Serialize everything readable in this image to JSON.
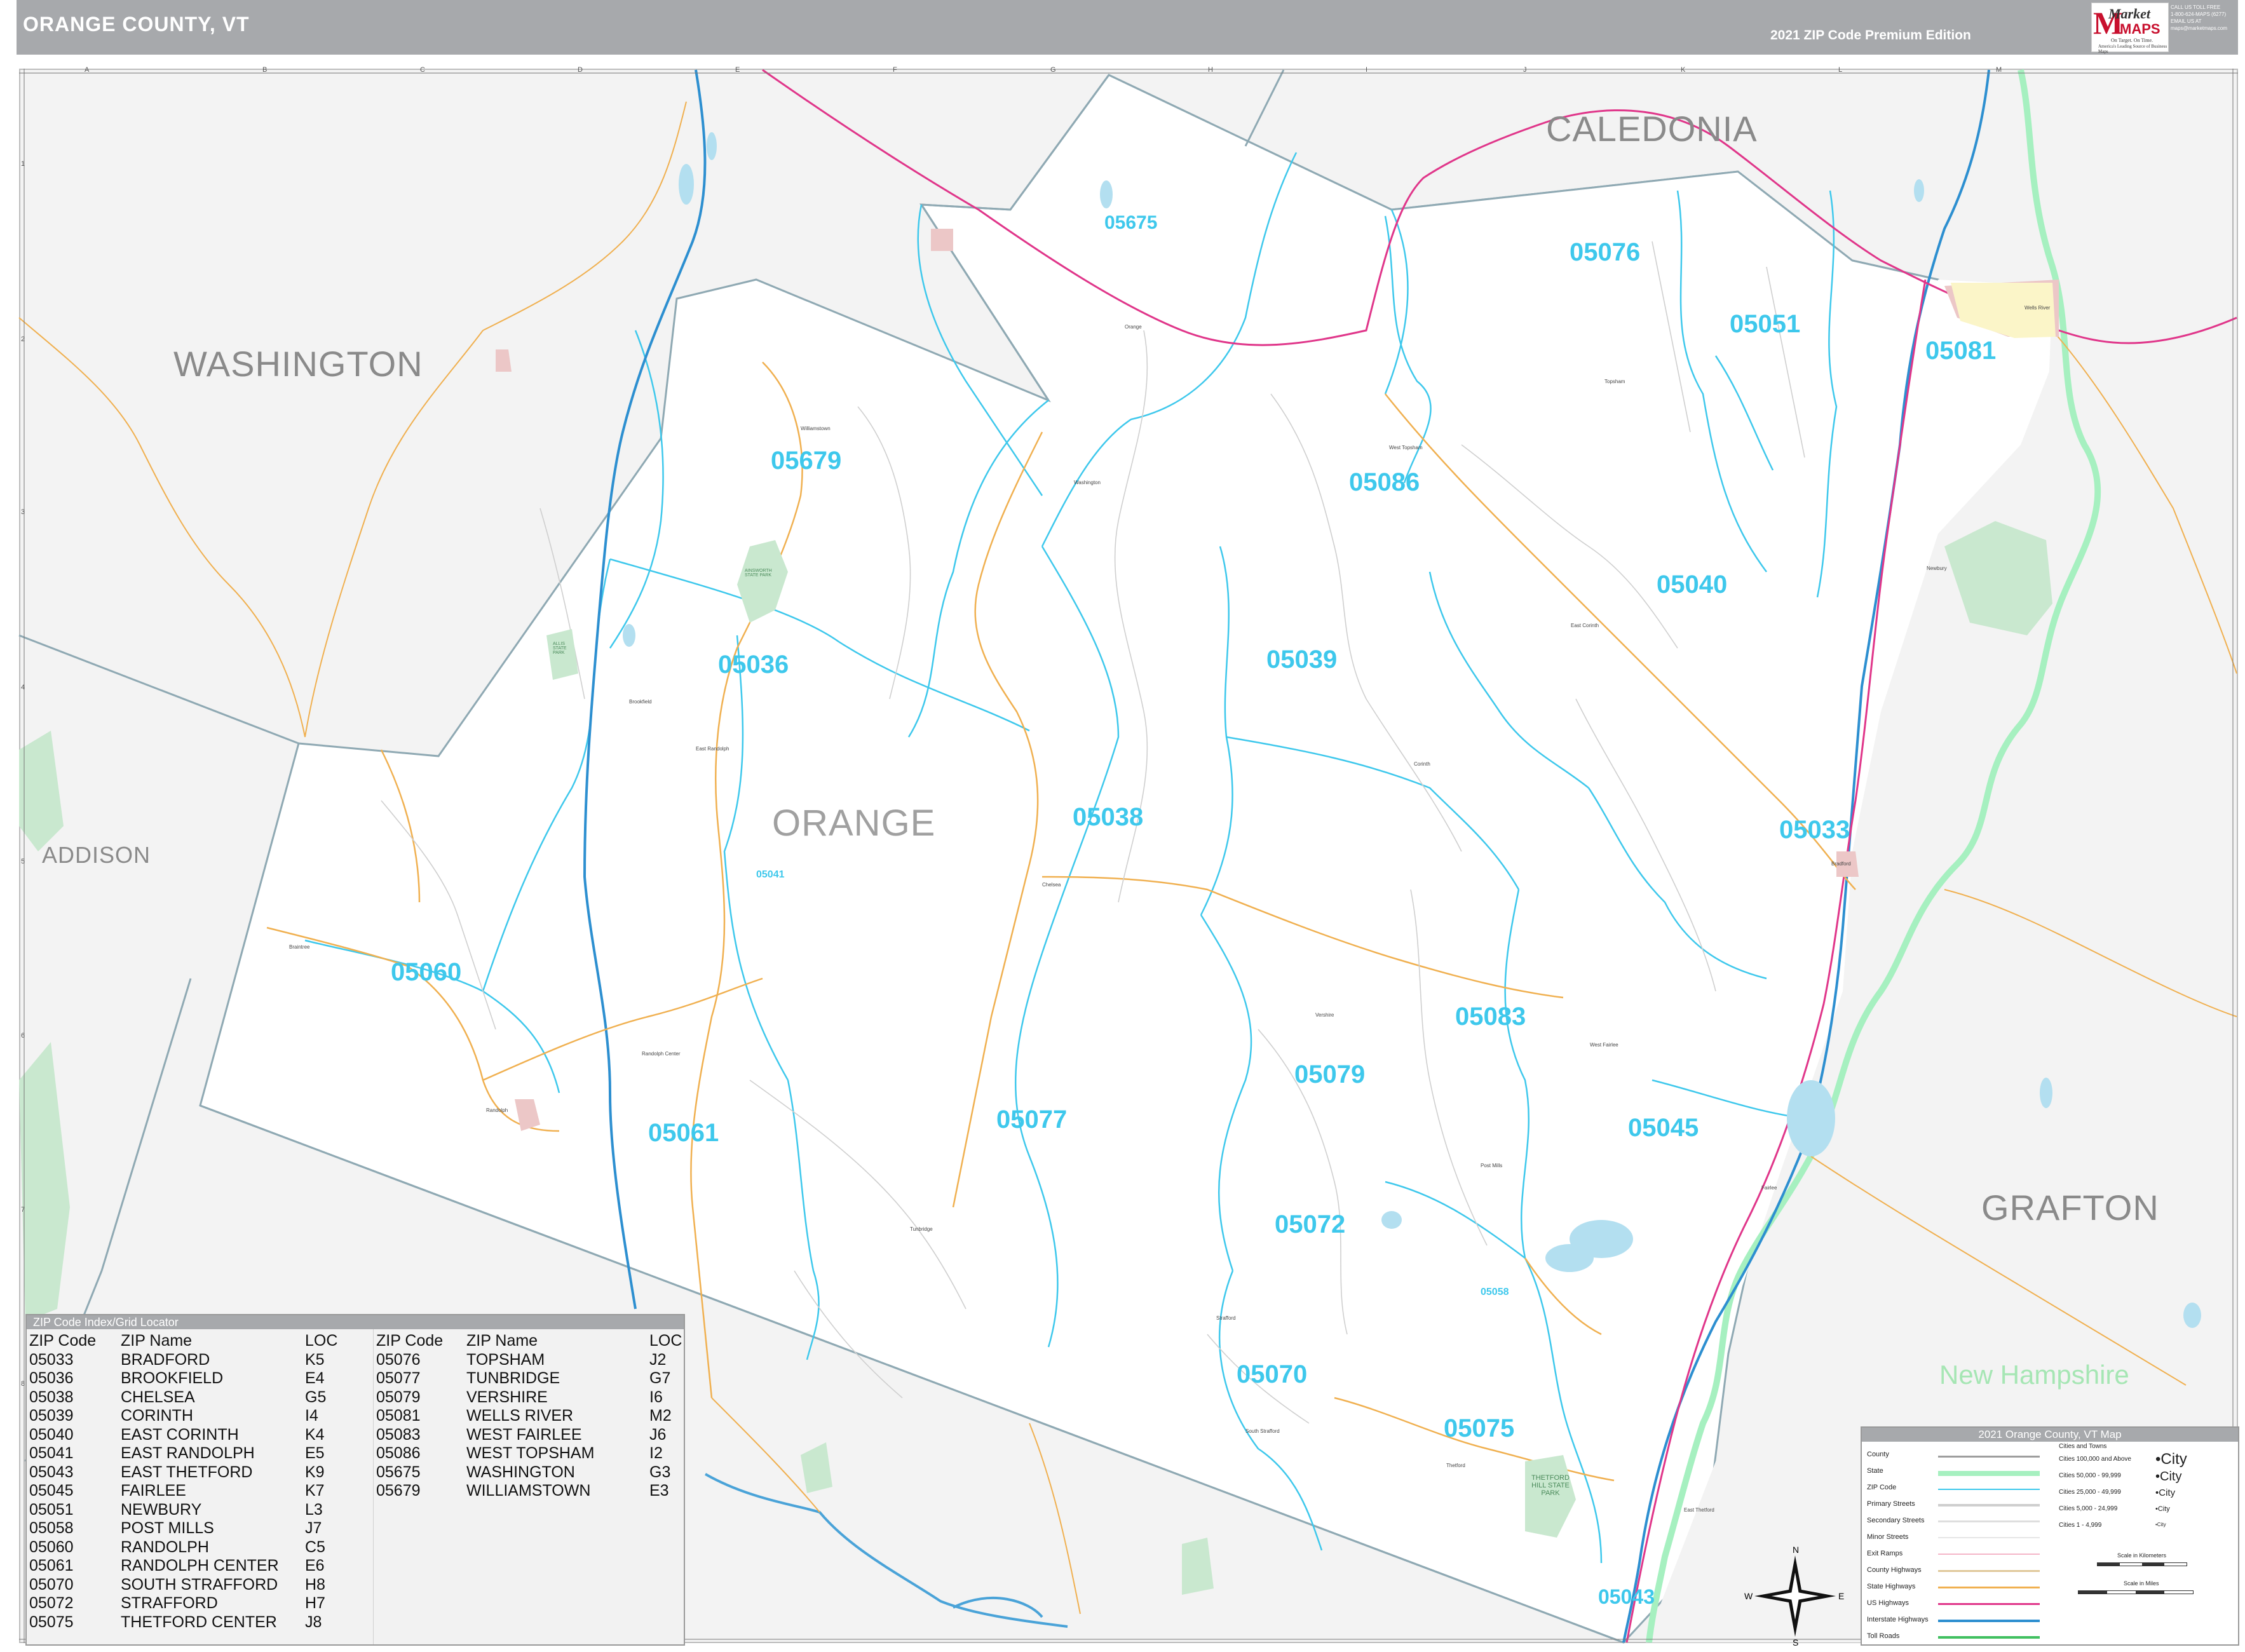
{
  "header": {
    "title": "ORANGE COUNTY, VT",
    "edition": "2021 ZIP Code Premium Edition",
    "logo": {
      "word1": "Market",
      "word2": "MAPS",
      "tagline1": "On Target. On Time.",
      "tagline2": "America's Leading Source of Business Maps"
    },
    "contact": [
      "CALL US TOLL FREE",
      "1-800-624-MAPS (6277)",
      "",
      "EMAIL US AT",
      "maps@marketmaps.com"
    ]
  },
  "map": {
    "grid_columns": [
      "A",
      "B",
      "C",
      "D",
      "E",
      "F",
      "G",
      "H",
      "I",
      "J",
      "K",
      "L",
      "M"
    ],
    "grid_rows": [
      "1",
      "2",
      "3",
      "4",
      "5",
      "6",
      "7",
      "8"
    ],
    "regions": {
      "caledonia": "CALEDONIA",
      "washington": "WASHINGTON",
      "addison": "ADDISON",
      "orange": "ORANGE",
      "grafton": "GRAFTON",
      "new_hampshire": "New Hampshire"
    },
    "zip_labels": {
      "z05675": "05675",
      "z05076": "05076",
      "z05051": "05051",
      "z05081": "05081",
      "z05679": "05679",
      "z05086": "05086",
      "z05040": "05040",
      "z05036": "05036",
      "z05039": "05039",
      "z05038": "05038",
      "z05033": "05033",
      "z05041": "05041",
      "z05060": "05060",
      "z05083": "05083",
      "z05079": "05079",
      "z05077": "05077",
      "z05061": "05061",
      "z05045": "05045",
      "z05072": "05072",
      "z05058": "05058",
      "z05070": "05070",
      "z05075": "05075",
      "z05043": "05043"
    },
    "places": {
      "orange": "Orange",
      "williamstown": "Williamstown",
      "washington": "Washington",
      "brookfield": "Brookfield",
      "east_randolph": "East Randolph",
      "randolph_center": "Randolph Center",
      "randolph": "Randolph",
      "braintree": "Braintree",
      "chelsea": "Chelsea",
      "tunbridge": "Tunbridge",
      "vershire": "Vershire",
      "west_fairlee": "West Fairlee",
      "fairlee": "Fairlee",
      "bradford": "Bradford",
      "newbury": "Newbury",
      "wells_river": "Wells River",
      "topsham": "Topsham",
      "corinth": "Corinth",
      "east_corinth": "East Corinth",
      "strafford": "Strafford",
      "thetford": "Thetford",
      "post_mills": "Post Mills",
      "east_thetford": "East Thetford",
      "south_strafford": "South Strafford",
      "west_topsham": "West Topsham",
      "thetford_hill_park": "THETFORD HILL STATE PARK",
      "allis_park": "ALLIS STATE PARK",
      "ainsworth_park": "AINSWORTH STATE PARK"
    }
  },
  "zip_index": {
    "title": "ZIP Code Index/Grid Locator",
    "headers": {
      "zip": "ZIP Code",
      "name": "ZIP Name",
      "loc": "LOC"
    },
    "col1": [
      {
        "zip": "05033",
        "name": "BRADFORD",
        "loc": "K5"
      },
      {
        "zip": "05036",
        "name": "BROOKFIELD",
        "loc": "E4"
      },
      {
        "zip": "05038",
        "name": "CHELSEA",
        "loc": "G5"
      },
      {
        "zip": "05039",
        "name": "CORINTH",
        "loc": "I4"
      },
      {
        "zip": "05040",
        "name": "EAST CORINTH",
        "loc": "K4"
      },
      {
        "zip": "05041",
        "name": "EAST RANDOLPH",
        "loc": "E5"
      },
      {
        "zip": "05043",
        "name": "EAST THETFORD",
        "loc": "K9"
      },
      {
        "zip": "05045",
        "name": "FAIRLEE",
        "loc": "K7"
      },
      {
        "zip": "05051",
        "name": "NEWBURY",
        "loc": "L3"
      },
      {
        "zip": "05058",
        "name": "POST MILLS",
        "loc": "J7"
      },
      {
        "zip": "05060",
        "name": "RANDOLPH",
        "loc": "C5"
      },
      {
        "zip": "05061",
        "name": "RANDOLPH CENTER",
        "loc": "E6"
      },
      {
        "zip": "05070",
        "name": "SOUTH STRAFFORD",
        "loc": "H8"
      },
      {
        "zip": "05072",
        "name": "STRAFFORD",
        "loc": "H7"
      },
      {
        "zip": "05075",
        "name": "THETFORD CENTER",
        "loc": "J8"
      }
    ],
    "col2": [
      {
        "zip": "05076",
        "name": "TOPSHAM",
        "loc": "J2"
      },
      {
        "zip": "05077",
        "name": "TUNBRIDGE",
        "loc": "G7"
      },
      {
        "zip": "05079",
        "name": "VERSHIRE",
        "loc": "I6"
      },
      {
        "zip": "05081",
        "name": "WELLS RIVER",
        "loc": "M2"
      },
      {
        "zip": "05083",
        "name": "WEST FAIRLEE",
        "loc": "J6"
      },
      {
        "zip": "05086",
        "name": "WEST TOPSHAM",
        "loc": "I2"
      },
      {
        "zip": "05675",
        "name": "WASHINGTON",
        "loc": "G3"
      },
      {
        "zip": "05679",
        "name": "WILLIAMSTOWN",
        "loc": "E3"
      }
    ]
  },
  "legend": {
    "title": "2021 Orange County, VT Map",
    "items": [
      "County",
      "State",
      "ZIP Code",
      "Primary Streets",
      "Secondary Streets",
      "Minor Streets",
      "Exit Ramps",
      "County Highways",
      "State Highways",
      "US Highways",
      "Interstate Highways",
      "Toll Roads"
    ],
    "cities_header": "Cities and Towns",
    "cities": [
      "Cities 100,000 and Above",
      "Cities 50,000 - 99,999",
      "Cities 25,000 - 49,999",
      "Cities 5,000 - 24,999",
      "Cities 1 - 4,999"
    ],
    "city_samples": [
      "•City",
      "•City",
      "•City",
      "•City",
      "•City"
    ],
    "scale_km": "Scale in Kilometers",
    "scale_mi": "Scale in Miles",
    "colors": {
      "county": "#9e9e9e",
      "state": "#a6f0c0",
      "zip": "#3ec8ec",
      "primary": "#cfcfcf",
      "secondary": "#dedede",
      "minor": "#eeeeee",
      "ramps": "#f4b6c8",
      "county_hwy": "#e0c89a",
      "state_hwy": "#f0b050",
      "us_hwy": "#e0368a",
      "interstate": "#2d8fd0",
      "toll": "#40c060"
    }
  },
  "compass": {
    "n": "N",
    "s": "S",
    "e": "E",
    "w": "W"
  }
}
